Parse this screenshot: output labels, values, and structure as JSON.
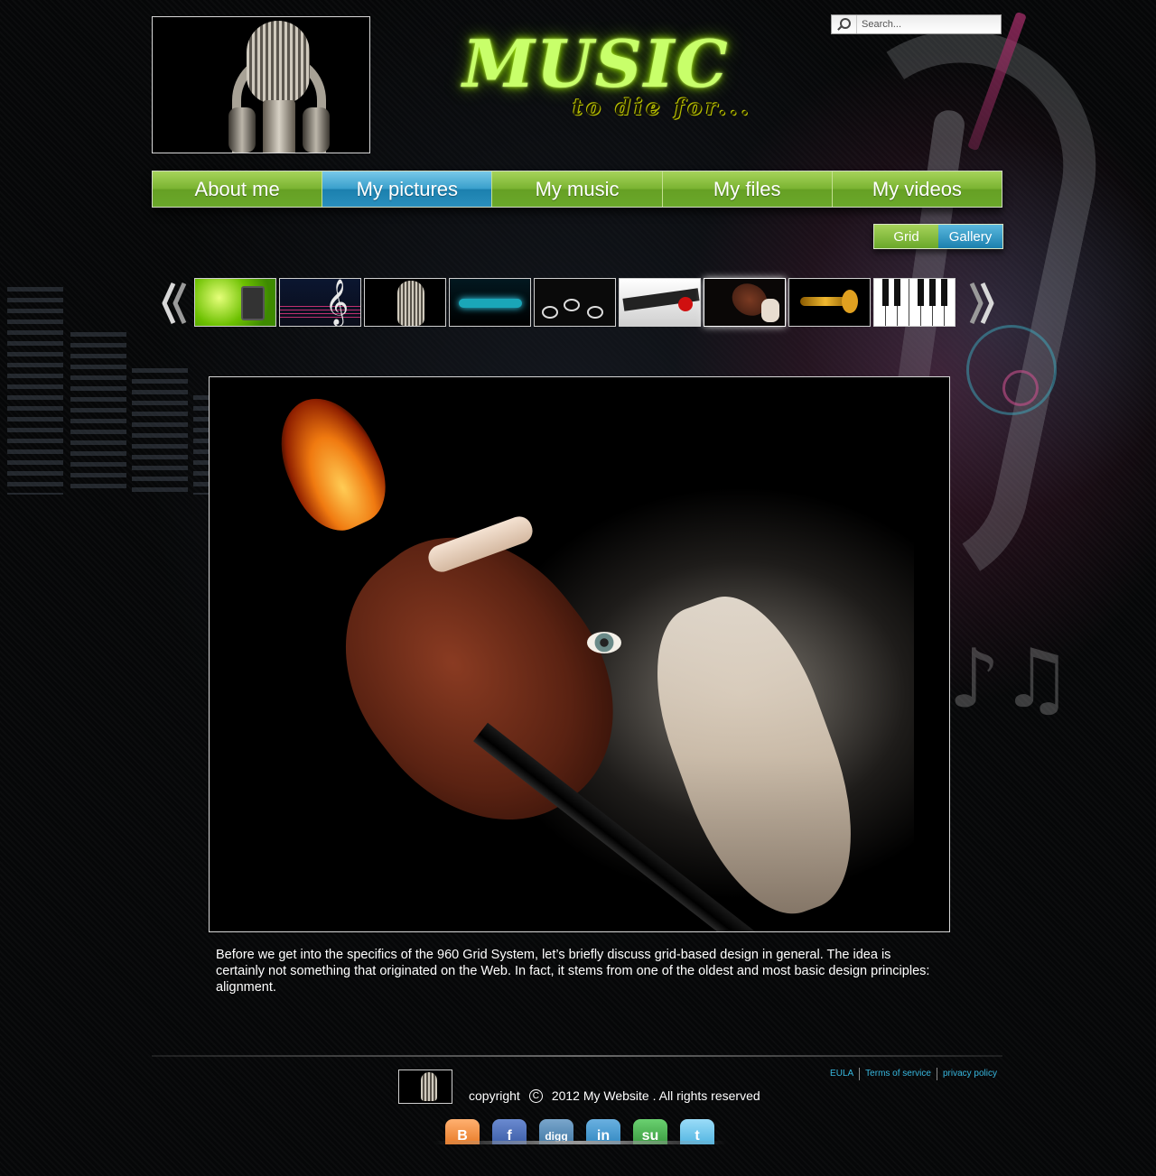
{
  "header": {
    "title": "MUSIC",
    "subtitle": "to die for...",
    "logo_icon": "microphone-headphones-image"
  },
  "search": {
    "placeholder": "Search...",
    "value": ""
  },
  "nav": {
    "items": [
      {
        "label": "About me",
        "active": false
      },
      {
        "label": "My pictures",
        "active": true
      },
      {
        "label": "My music",
        "active": false
      },
      {
        "label": "My files",
        "active": false
      },
      {
        "label": "My videos",
        "active": false
      }
    ]
  },
  "view_toggle": {
    "grid_label": "Grid",
    "gallery_label": "Gallery",
    "selected": "Gallery"
  },
  "gallery": {
    "prev_icon": "double-chevron-left-icon",
    "next_icon": "double-chevron-right-icon",
    "thumbnails": [
      {
        "name": "green-speaker"
      },
      {
        "name": "treble-clef"
      },
      {
        "name": "microphone"
      },
      {
        "name": "neon-guitar"
      },
      {
        "name": "drum-kit"
      },
      {
        "name": "piano-rose"
      },
      {
        "name": "violin-girl",
        "selected": true
      },
      {
        "name": "trumpet"
      },
      {
        "name": "piano-keys"
      }
    ],
    "selected_index": 6
  },
  "main": {
    "caption": "Before we get into the specifics of the 960 Grid System, let’s briefly discuss grid-based design in general. The idea is certainly not something that originated on the Web. In fact, it stems from one of the oldest and most basic design principles: alignment."
  },
  "footer": {
    "copyright_prefix": "copyright",
    "copyright_symbol": "C",
    "copyright_text": "2012 My Website . All rights reserved",
    "legal_links": [
      "EULA",
      "Terms of service",
      "privacy policy"
    ],
    "social": [
      {
        "name": "blogger",
        "glyph": "B"
      },
      {
        "name": "facebook",
        "glyph": "f"
      },
      {
        "name": "digg",
        "glyph": "digg"
      },
      {
        "name": "linkedin",
        "glyph": "in"
      },
      {
        "name": "stumbleupon",
        "glyph": "su"
      },
      {
        "name": "twitter",
        "glyph": "t"
      }
    ]
  },
  "colors": {
    "nav_green": "#7bb432",
    "nav_active_blue": "#1b80ae",
    "title_glow": "#9be000",
    "link_blue": "#38b8e0",
    "background": "#060708"
  }
}
